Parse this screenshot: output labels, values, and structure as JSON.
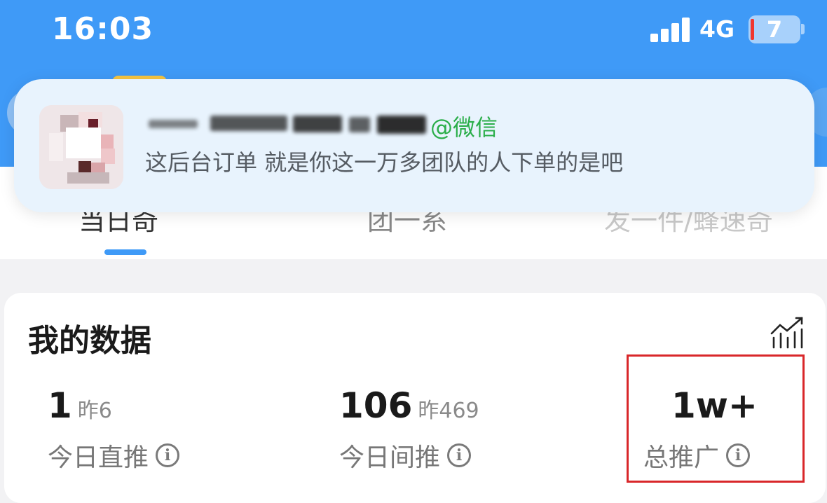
{
  "status_bar": {
    "time": "16:03",
    "network": "4G",
    "battery": "7"
  },
  "notification": {
    "app": "@微信",
    "message": "这后台订单 就是你这一万多团队的人下单的是吧"
  },
  "tabs": [
    {
      "label": "当日奇"
    },
    {
      "label": "团一系"
    },
    {
      "label": "发一件/蜂速奇"
    }
  ],
  "my_data": {
    "title": "我的数据",
    "stats": [
      {
        "value": "1",
        "prev": "昨6",
        "label": "今日直推"
      },
      {
        "value": "106",
        "prev": "昨469",
        "label": "今日间推"
      },
      {
        "value": "1w+",
        "prev": "",
        "label": "总推广"
      }
    ]
  },
  "colors": {
    "header_blue": "#3f9af7",
    "wechat_green": "#2aae49",
    "highlight_red": "#d9272a"
  }
}
